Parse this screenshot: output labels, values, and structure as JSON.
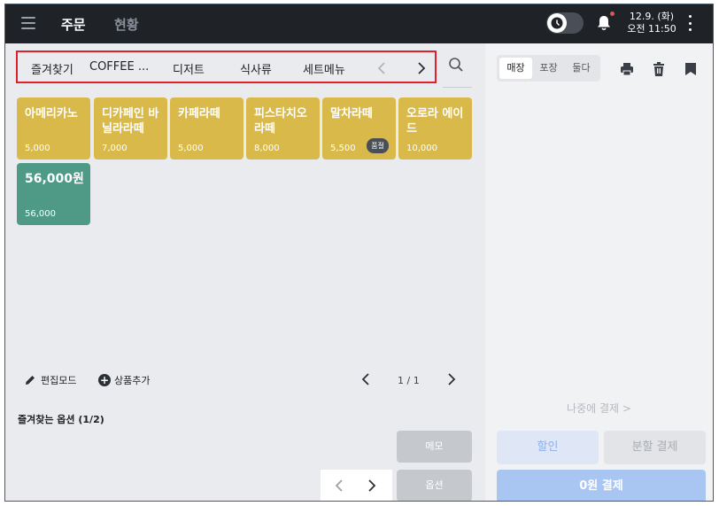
{
  "topbar": {
    "tab_order": "주문",
    "tab_status": "현황",
    "date": "12.9. (화)",
    "time": "오전 11:50"
  },
  "categories": {
    "items": [
      "즐겨찾기",
      "COFFEE ...",
      "디저트",
      "식사류",
      "세트메뉴"
    ]
  },
  "products": [
    {
      "name": "아메리카노",
      "price": "5,000"
    },
    {
      "name": "디카페인 바닐라라떼",
      "price": "7,000"
    },
    {
      "name": "카페라떼",
      "price": "5,000"
    },
    {
      "name": "피스타치오 라떼",
      "price": "8,000"
    },
    {
      "name": "말차라떼",
      "price": "5,500",
      "badge": "품절"
    },
    {
      "name": "오로라 에이드",
      "price": "10,000"
    },
    {
      "name": "56,000원",
      "price": "56,000"
    }
  ],
  "toolbar": {
    "edit_mode": "편집모드",
    "add_item": "상품추가",
    "page": "1 / 1"
  },
  "options": {
    "title": "즐겨찾는 옵션 (1/2)",
    "memo": "메모",
    "option": "옵션"
  },
  "right_panel": {
    "seg": [
      "매장",
      "포장",
      "둘다"
    ],
    "pay_later": "나중에 결제 >",
    "discount": "할인",
    "split": "분할 결제",
    "pay": "0원 결제"
  },
  "colors": {
    "topbar": "#1f2328",
    "tile_yellow": "#d9b94a",
    "tile_green": "#4e9a86",
    "highlight": "#e0202a",
    "pay_button": "#a9c6f3"
  }
}
